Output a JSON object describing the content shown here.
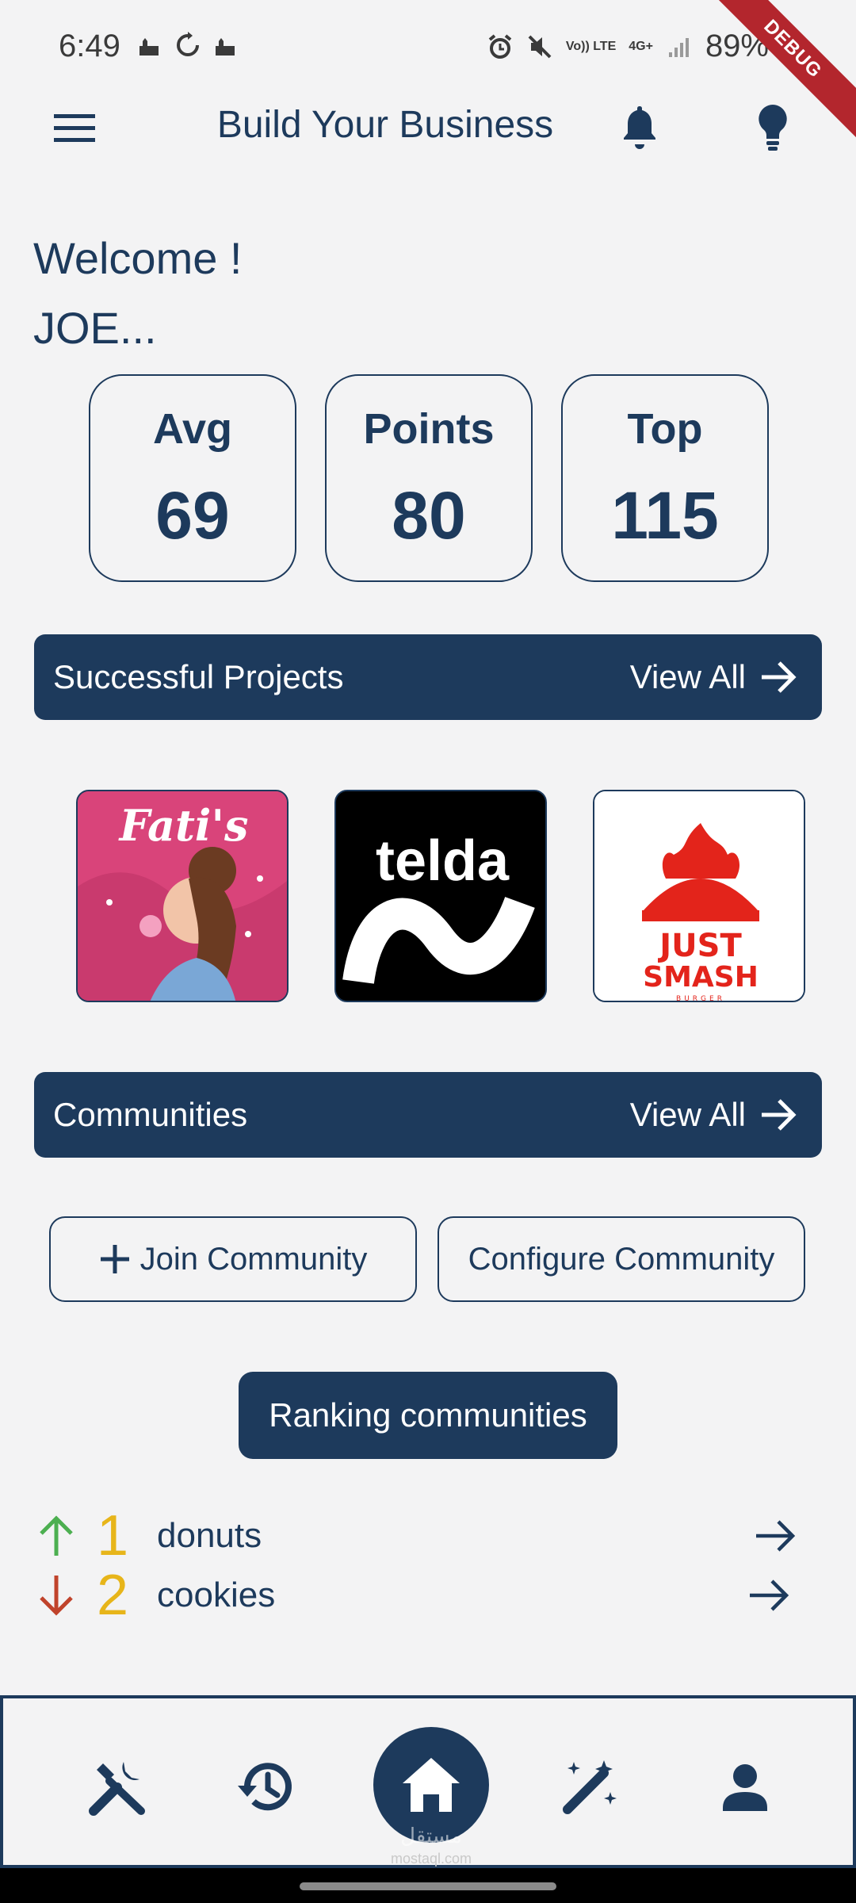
{
  "status_bar": {
    "time": "6:49",
    "battery": "89%",
    "volte": "Vo)) LTE",
    "network": "4G+",
    "icons": [
      "mosque-icon",
      "sync-icon",
      "mosque-icon",
      "alarm-icon",
      "mute-icon",
      "volte-icon",
      "network-4g-icon",
      "signal-icon",
      "battery-icon"
    ]
  },
  "debug_banner": "DEBUG",
  "app_bar": {
    "title": "Build Your Business",
    "icons": [
      "menu-icon",
      "bell-icon",
      "lightbulb-icon"
    ]
  },
  "welcome": {
    "line1": "Welcome !",
    "line2": "JOE..."
  },
  "stats": [
    {
      "label": "Avg",
      "value": "69"
    },
    {
      "label": "Points",
      "value": "80"
    },
    {
      "label": "Top",
      "value": "115"
    }
  ],
  "projects_section": {
    "title": "Successful Projects",
    "view_all": "View All",
    "items": [
      {
        "name": "Fati's",
        "text": "Fati's"
      },
      {
        "name": "telda",
        "text": "telda"
      },
      {
        "name": "Just Smash",
        "text1": "JUST",
        "text2": "SMASH",
        "text3": "BURGER"
      }
    ]
  },
  "communities_section": {
    "title": "Communities",
    "view_all": "View All",
    "join_label": "Join Community",
    "configure_label": "Configure Community",
    "ranking_label": "Ranking communities"
  },
  "ranking": [
    {
      "rank": "1",
      "name": "donuts",
      "trend": "up",
      "trend_color": "#4caf50"
    },
    {
      "rank": "2",
      "name": "cookies",
      "trend": "down",
      "trend_color": "#c0432b"
    }
  ],
  "bottom_nav": {
    "items": [
      "tools-icon",
      "history-icon",
      "home-icon",
      "magic-wand-icon",
      "person-icon"
    ],
    "watermark_ar": "مستقل",
    "watermark_en": "mostaql.com"
  },
  "colors": {
    "primary": "#1d3a5c",
    "background": "#f3f3f4",
    "rank_number": "#e7b51a",
    "up": "#4caf50",
    "down": "#c0432b"
  }
}
